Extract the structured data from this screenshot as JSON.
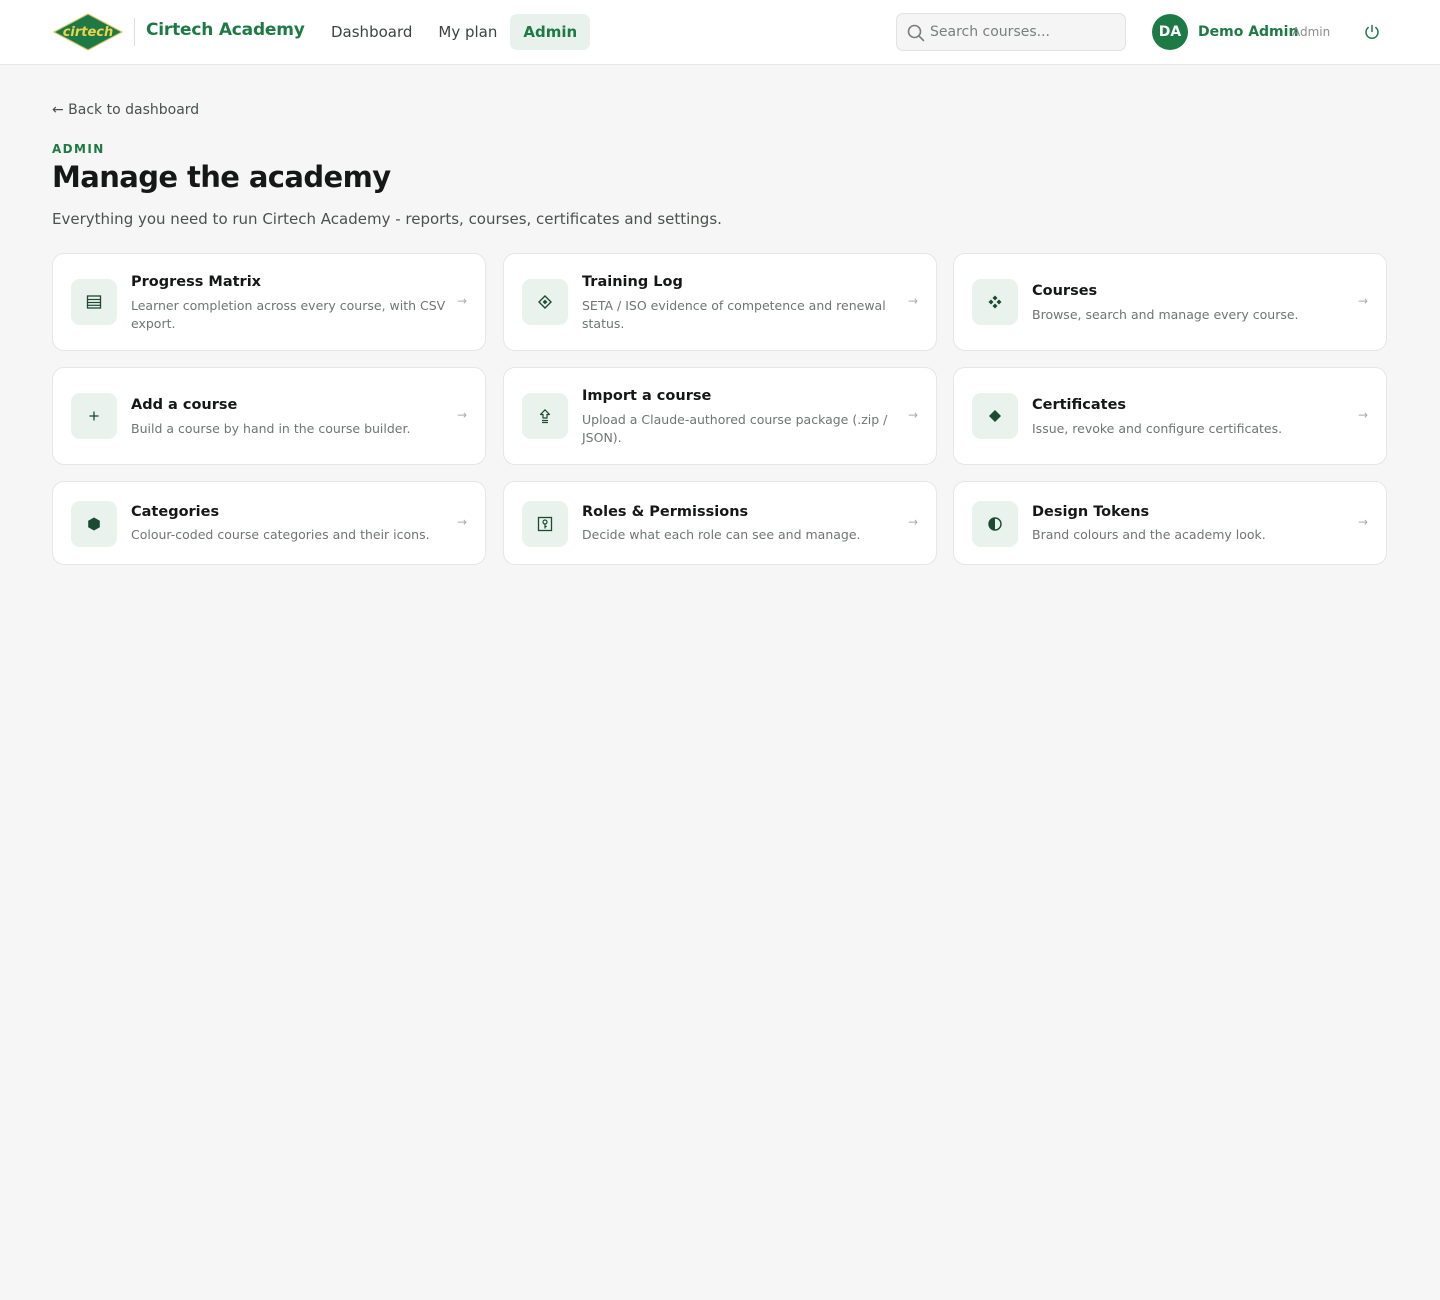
{
  "header": {
    "logo_text": "cirtech",
    "brand": "Cirtech Academy",
    "nav": [
      {
        "label": "Dashboard"
      },
      {
        "label": "My plan"
      },
      {
        "label": "Admin"
      }
    ],
    "search": {
      "placeholder": "Search courses..."
    },
    "user": {
      "initials": "DA",
      "name": "Demo Admin",
      "role": "Admin"
    },
    "accent": "#1e7a45"
  },
  "page": {
    "back": "← Back to dashboard",
    "eyebrow": "ADMIN",
    "title": "Manage the academy",
    "subtitle": "Everything you need to run Cirtech Academy - reports, courses, certificates and settings."
  },
  "cards": [
    {
      "icon": "table-icon",
      "title": "Progress Matrix",
      "desc": "Learner completion across every course, with CSV export.",
      "arrow": "→"
    },
    {
      "icon": "diamond-outline-icon",
      "title": "Training Log",
      "desc": "SETA / ISO evidence of competence and renewal status.",
      "arrow": "→"
    },
    {
      "icon": "four-diamonds-icon",
      "title": "Courses",
      "desc": "Browse, search and manage every course.",
      "arrow": "→"
    },
    {
      "icon": "plus-icon",
      "title": "Add a course",
      "desc": "Build a course by hand in the course builder.",
      "arrow": "→"
    },
    {
      "icon": "upload-icon",
      "title": "Import a course",
      "desc": "Upload a Claude-authored course package (.zip / JSON).",
      "arrow": "→"
    },
    {
      "icon": "diamond-icon",
      "title": "Certificates",
      "desc": "Issue, revoke and configure certificates.",
      "arrow": "→"
    },
    {
      "icon": "hexagon-icon",
      "title": "Categories",
      "desc": "Colour-coded course categories and their icons.",
      "arrow": "→"
    },
    {
      "icon": "key-icon",
      "title": "Roles & Permissions",
      "desc": "Decide what each role can see and manage.",
      "arrow": "→"
    },
    {
      "icon": "half-circle-icon",
      "title": "Design Tokens",
      "desc": "Brand colours and the academy look.",
      "arrow": "→"
    }
  ]
}
